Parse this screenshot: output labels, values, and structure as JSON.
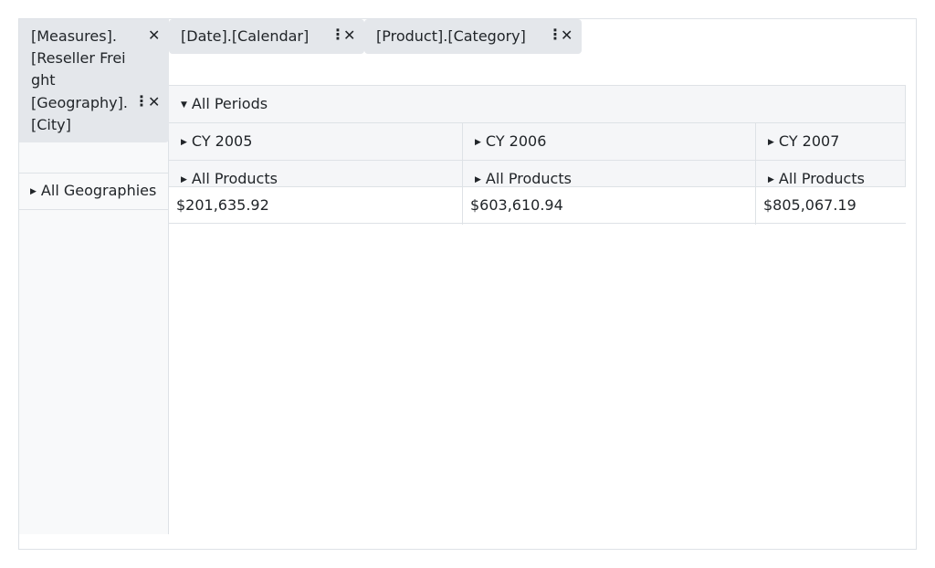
{
  "filters": {
    "measures": {
      "label_line1": "[Measures].[Reseller Freight",
      "label_line2": "[Geography].[City]"
    },
    "columns": [
      {
        "label": "[Date].[Calendar]"
      },
      {
        "label": "[Product].[Category]"
      }
    ],
    "icons": {
      "kebab": "⋮",
      "close": "✕"
    }
  },
  "grid": {
    "all_periods": "All Periods",
    "years": [
      "CY 2005",
      "CY 2006",
      "CY 2007"
    ],
    "products": [
      "All Products",
      "All Products",
      "All Products"
    ],
    "values": [
      "$201,635.92",
      "$603,610.94",
      "$805,067.19"
    ]
  },
  "rows": {
    "all_geographies": "All Geographies"
  },
  "carets": {
    "expanded": "▼",
    "collapsed": "▶"
  }
}
